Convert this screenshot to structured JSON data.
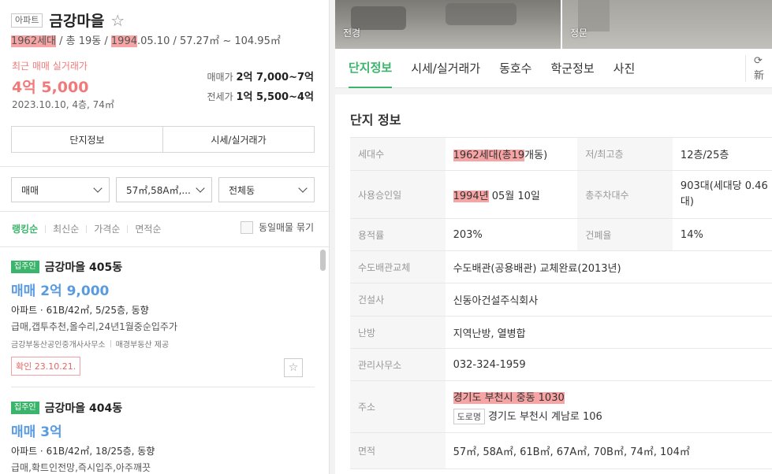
{
  "complex": {
    "badge": "아파트",
    "name": "금강마을",
    "households": "1962세대",
    "buildings": " / 총 19동 / ",
    "approval_year": "1994",
    "approval_rest": ".05.10 / 57.27㎡ ~ 104.95㎡"
  },
  "recent_trade": {
    "label": "최근 매매 실거래가",
    "price": "4억 5,000",
    "detail": "2023.10.10, 4층, 74㎡"
  },
  "price_ranges": {
    "sale_label": "매매가",
    "sale_value": "2억 7,000~7억",
    "jeonse_label": "전세가",
    "jeonse_value": "1억 5,500~4억"
  },
  "left_buttons": [
    "단지정보",
    "시세/실거래가"
  ],
  "filters": [
    "매매",
    "57㎡,58A㎡,...",
    "전체동"
  ],
  "sort_options": [
    "랭킹순",
    "최신순",
    "가격순",
    "면적순"
  ],
  "group_label": "동일매물 묶기",
  "listings": [
    {
      "tag": "집주인",
      "name": "금강마을 405동",
      "price": "매매 2억 9,000",
      "desc": "아파트 · 61B/42㎡, 5/25층, 동향",
      "note": "급매,갭투추천,올수리,24년1월중순입주가",
      "agent": "금강부동산공인중개사사무소",
      "provider": "매경부동산 제공",
      "confirm": "확인 23.10.21."
    },
    {
      "tag": "집주인",
      "name": "금강마을 404동",
      "price": "매매 3억",
      "desc": "아파트 · 61B/42㎡, 18/25층, 동향",
      "note": "급매,확트인전망,즉시입주,아주깨끗"
    }
  ],
  "photos": [
    "전경",
    "정문"
  ],
  "tabs": [
    "단지정보",
    "시세/실거래가",
    "동호수",
    "학군정보",
    "사진"
  ],
  "refresh_glyph": "⟳ 新",
  "section_title": "단지 정보",
  "info": {
    "households_label": "세대수",
    "households_hl": "1962세대(총19",
    "households_rest": "개동)",
    "floors_label": "저/최고층",
    "floors_value": "12층/25층",
    "approval_label": "사용승인일",
    "approval_hl": "1994년",
    "approval_rest": " 05월 10일",
    "parking_label": "총주차대수",
    "parking_value": "903대(세대당 0.46대)",
    "far_label": "용적률",
    "far_value": "203%",
    "bcr_label": "건폐율",
    "bcr_value": "14%",
    "pipe_label": "수도배관교체",
    "pipe_value": "수도배관(공용배관) 교체완료(2013년)",
    "builder_label": "건설사",
    "builder_value": "신동아건설주식회사",
    "heating_label": "난방",
    "heating_value": "지역난방, 열병합",
    "office_label": "관리사무소",
    "office_value": "032-324-1959",
    "address_label": "주소",
    "address_value": "경기도 부천시 중동 1030",
    "road_tag": "도로명",
    "road_value": "경기도 부천시 계남로 106",
    "area_label": "면적",
    "area_value": "57㎡, 58A㎡, 61B㎡, 67A㎡, 70B㎡, 74㎡, 104㎡"
  }
}
